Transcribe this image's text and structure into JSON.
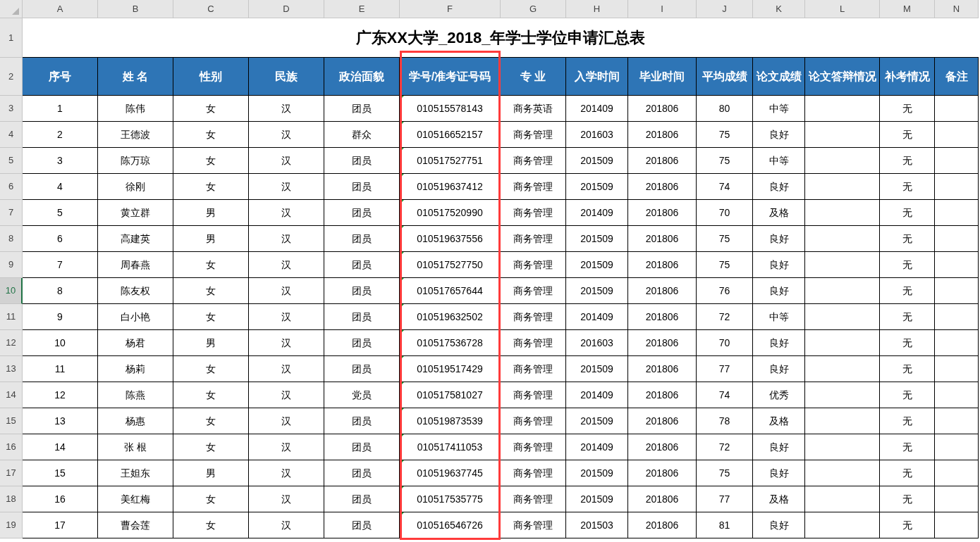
{
  "column_letters": [
    {
      "label": "A"
    },
    {
      "label": "B"
    },
    {
      "label": "C"
    },
    {
      "label": "D"
    },
    {
      "label": "E"
    },
    {
      "label": "F"
    },
    {
      "label": "G"
    },
    {
      "label": "H"
    },
    {
      "label": "I"
    },
    {
      "label": "J"
    },
    {
      "label": "K"
    },
    {
      "label": "L"
    },
    {
      "label": "M"
    },
    {
      "label": "N"
    }
  ],
  "row_numbers": [
    {
      "label": "1",
      "selected": false
    },
    {
      "label": "2",
      "selected": false
    },
    {
      "label": "3",
      "selected": false
    },
    {
      "label": "4",
      "selected": false
    },
    {
      "label": "5",
      "selected": false
    },
    {
      "label": "6",
      "selected": false
    },
    {
      "label": "7",
      "selected": false
    },
    {
      "label": "8",
      "selected": false
    },
    {
      "label": "9",
      "selected": false
    },
    {
      "label": "10",
      "selected": true
    },
    {
      "label": "11",
      "selected": false
    },
    {
      "label": "12",
      "selected": false
    },
    {
      "label": "13",
      "selected": false
    },
    {
      "label": "14",
      "selected": false
    },
    {
      "label": "15",
      "selected": false
    },
    {
      "label": "16",
      "selected": false
    },
    {
      "label": "17",
      "selected": false
    },
    {
      "label": "18",
      "selected": false
    },
    {
      "label": "19",
      "selected": false
    }
  ],
  "title": "广东XX大学_2018_年学士学位申请汇总表",
  "table": {
    "columns": [
      {
        "label": "序号",
        "kind": "data",
        "highlighted": false,
        "marked": false
      },
      {
        "label": "姓 名",
        "kind": "data",
        "highlighted": false,
        "marked": false
      },
      {
        "label": "性别",
        "kind": "data",
        "highlighted": false,
        "marked": false
      },
      {
        "label": "民族",
        "kind": "data",
        "highlighted": false,
        "marked": false
      },
      {
        "label": "政治面貌",
        "kind": "data",
        "highlighted": false,
        "marked": false
      },
      {
        "label": "学号/准考证号码",
        "kind": "data",
        "highlighted": true,
        "marked": true
      },
      {
        "label": "专 业",
        "kind": "data",
        "highlighted": false,
        "marked": false
      },
      {
        "label": "入学时间",
        "kind": "data",
        "highlighted": false,
        "marked": false
      },
      {
        "label": "毕业时间",
        "kind": "data",
        "highlighted": false,
        "marked": false
      },
      {
        "label": "平均成绩",
        "kind": "data",
        "highlighted": false,
        "marked": false
      },
      {
        "label": "论文成绩",
        "kind": "data",
        "highlighted": false,
        "marked": false
      },
      {
        "label": "论文答辩情况",
        "kind": "blank",
        "highlighted": false,
        "marked": false
      },
      {
        "label": "补考情况",
        "kind": "data",
        "highlighted": false,
        "marked": false
      },
      {
        "label": "备注",
        "kind": "blank",
        "highlighted": false,
        "marked": false
      }
    ],
    "rows": [
      {
        "cells": [
          "1",
          "陈伟",
          "女",
          "汉",
          "团员",
          "010515578143",
          "商务英语",
          "201409",
          "201806",
          "80",
          "中等",
          "无"
        ]
      },
      {
        "cells": [
          "2",
          "王德波",
          "女",
          "汉",
          "群众",
          "010516652157",
          "商务管理",
          "201603",
          "201806",
          "75",
          "良好",
          "无"
        ]
      },
      {
        "cells": [
          "3",
          "陈万琼",
          "女",
          "汉",
          "团员",
          "010517527751",
          "商务管理",
          "201509",
          "201806",
          "75",
          "中等",
          "无"
        ]
      },
      {
        "cells": [
          "4",
          "徐刚",
          "女",
          "汉",
          "团员",
          "010519637412",
          "商务管理",
          "201509",
          "201806",
          "74",
          "良好",
          "无"
        ]
      },
      {
        "cells": [
          "5",
          "黄立群",
          "男",
          "汉",
          "团员",
          "010517520990",
          "商务管理",
          "201409",
          "201806",
          "70",
          "及格",
          "无"
        ]
      },
      {
        "cells": [
          "6",
          "高建英",
          "男",
          "汉",
          "团员",
          "010519637556",
          "商务管理",
          "201509",
          "201806",
          "75",
          "良好",
          "无"
        ]
      },
      {
        "cells": [
          "7",
          "周春燕",
          "女",
          "汉",
          "团员",
          "010517527750",
          "商务管理",
          "201509",
          "201806",
          "75",
          "良好",
          "无"
        ]
      },
      {
        "cells": [
          "8",
          "陈友权",
          "女",
          "汉",
          "团员",
          "010517657644",
          "商务管理",
          "201509",
          "201806",
          "76",
          "良好",
          "无"
        ]
      },
      {
        "cells": [
          "9",
          "白小艳",
          "女",
          "汉",
          "团员",
          "010519632502",
          "商务管理",
          "201409",
          "201806",
          "72",
          "中等",
          "无"
        ]
      },
      {
        "cells": [
          "10",
          "杨君",
          "男",
          "汉",
          "团员",
          "010517536728",
          "商务管理",
          "201603",
          "201806",
          "70",
          "良好",
          "无"
        ]
      },
      {
        "cells": [
          "11",
          "杨莉",
          "女",
          "汉",
          "团员",
          "010519517429",
          "商务管理",
          "201509",
          "201806",
          "77",
          "良好",
          "无"
        ]
      },
      {
        "cells": [
          "12",
          "陈燕",
          "女",
          "汉",
          "党员",
          "010517581027",
          "商务管理",
          "201409",
          "201806",
          "74",
          "优秀",
          "无"
        ]
      },
      {
        "cells": [
          "13",
          "杨惠",
          "女",
          "汉",
          "团员",
          "010519873539",
          "商务管理",
          "201509",
          "201806",
          "78",
          "及格",
          "无"
        ]
      },
      {
        "cells": [
          "14",
          "张 根",
          "女",
          "汉",
          "团员",
          "010517411053",
          "商务管理",
          "201409",
          "201806",
          "72",
          "良好",
          "无"
        ]
      },
      {
        "cells": [
          "15",
          "王妲东",
          "男",
          "汉",
          "团员",
          "010519637745",
          "商务管理",
          "201509",
          "201806",
          "75",
          "良好",
          "无"
        ]
      },
      {
        "cells": [
          "16",
          "美红梅",
          "女",
          "汉",
          "团员",
          "010517535775",
          "商务管理",
          "201509",
          "201806",
          "77",
          "及格",
          "无"
        ]
      },
      {
        "cells": [
          "17",
          "曹会莲",
          "女",
          "汉",
          "团员",
          "010516546726",
          "商务管理",
          "201503",
          "201806",
          "81",
          "良好",
          "无"
        ]
      }
    ]
  }
}
